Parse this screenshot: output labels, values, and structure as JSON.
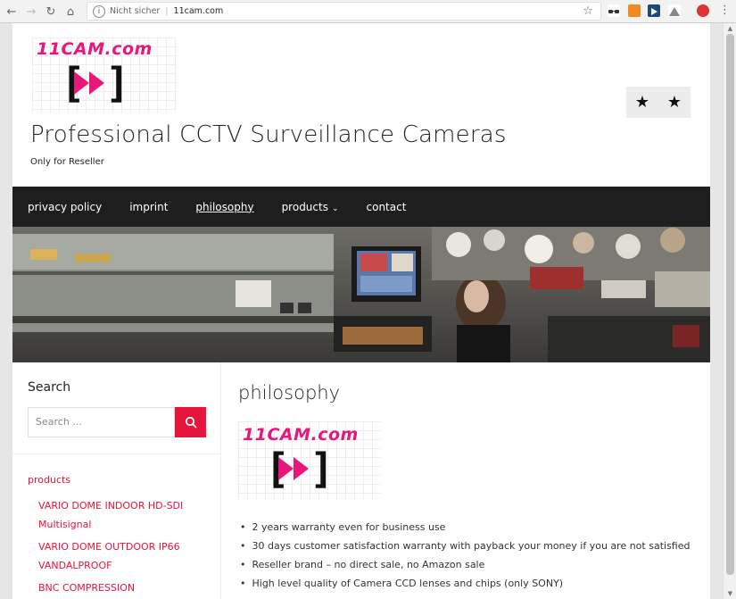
{
  "browser": {
    "security_label": "Nicht sicher",
    "separator": "|",
    "url": "11cam.com"
  },
  "site": {
    "logo_text": "11CAM.com",
    "title": "Professional CCTV Surveillance Cameras",
    "tagline": "Only for Reseller"
  },
  "nav": {
    "items": [
      {
        "label": "privacy policy"
      },
      {
        "label": "imprint"
      },
      {
        "label": "philosophy"
      },
      {
        "label": "products"
      },
      {
        "label": "contact"
      }
    ]
  },
  "sidebar": {
    "search_title": "Search",
    "search_placeholder": "Search ...",
    "categories_title": "products",
    "categories": [
      {
        "label": "VARIO DOME INDOOR HD-SDI"
      },
      {
        "label": "Multisignal"
      },
      {
        "label": "VARIO DOME OUTDOOR IP66"
      },
      {
        "label": "VANDALPROOF"
      },
      {
        "label": "BNC COMPRESSION"
      }
    ]
  },
  "content": {
    "heading": "philosophy",
    "logo_text": "11CAM.com",
    "bullets": [
      "2 years warranty even for business use",
      "30 days customer satisfaction warranty with payback your money if you are not satisfied",
      "Reseller brand – no direct sale, no Amazon sale",
      "High level quality of Camera CCD lenses and chips (only SONY)"
    ]
  },
  "colors": {
    "accent": "#e5143a",
    "logo_pink": "#e8177c",
    "nav_bg": "#1e1e1e"
  }
}
